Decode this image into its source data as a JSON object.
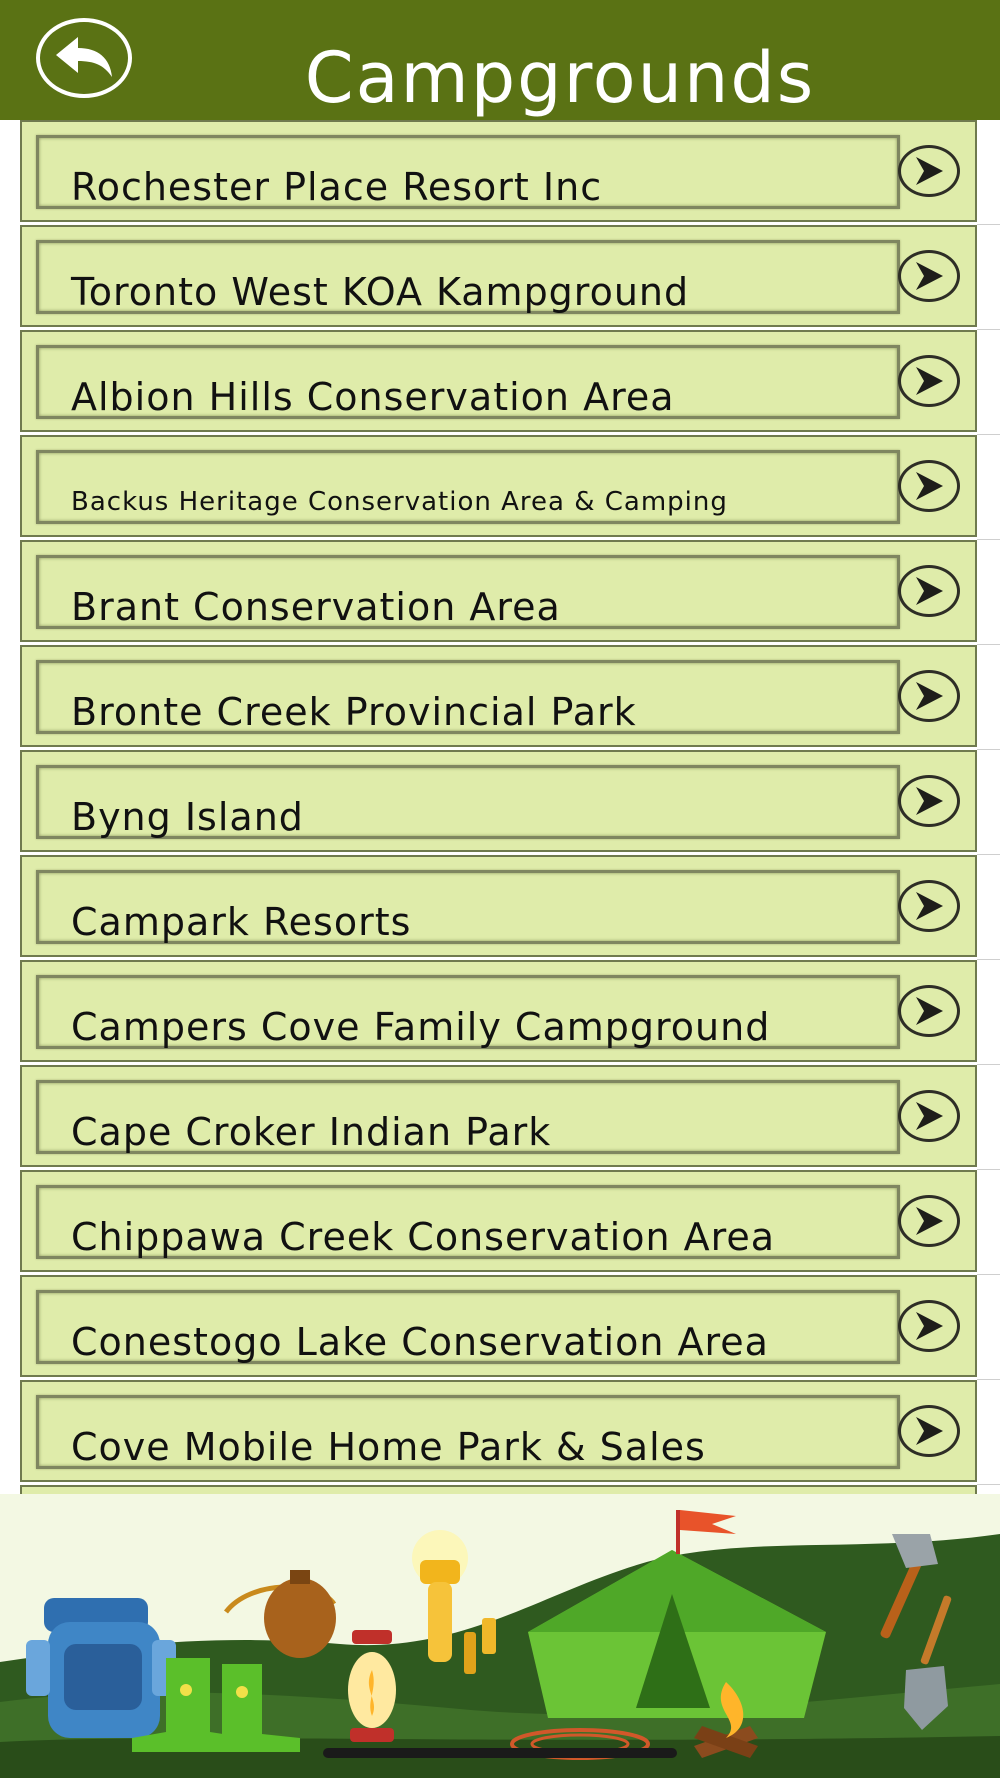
{
  "header": {
    "title": "Campgrounds",
    "back_icon": "back-arrow-icon",
    "color": "#5a7214"
  },
  "list": {
    "row_background": "#dfecaa",
    "arrow_icon": "chevron-right-circle-icon",
    "items": [
      {
        "label": "Rochester Place Resort Inc"
      },
      {
        "label": "Toronto West KOA Kampground"
      },
      {
        "label": "Albion Hills Conservation Area"
      },
      {
        "label": "Backus Heritage Conservation Area & Camping"
      },
      {
        "label": "Brant Conservation Area"
      },
      {
        "label": "Bronte Creek Provincial Park"
      },
      {
        "label": "Byng Island"
      },
      {
        "label": "Campark Resorts"
      },
      {
        "label": "Campers Cove Family Campground"
      },
      {
        "label": "Cape Croker Indian Park"
      },
      {
        "label": "Chippawa Creek Conservation Area"
      },
      {
        "label": "Conestogo Lake Conservation Area"
      },
      {
        "label": "Cove Mobile Home Park & Sales"
      }
    ]
  },
  "footer": {
    "illustration_icons": [
      "backpack-icon",
      "rubber-boots-icon",
      "canteen-icon",
      "lantern-icon",
      "flashlight-icon",
      "batteries-icon",
      "tent-icon",
      "flag-icon",
      "campfire-icon",
      "rope-icon",
      "axe-icon",
      "shovel-icon"
    ]
  }
}
